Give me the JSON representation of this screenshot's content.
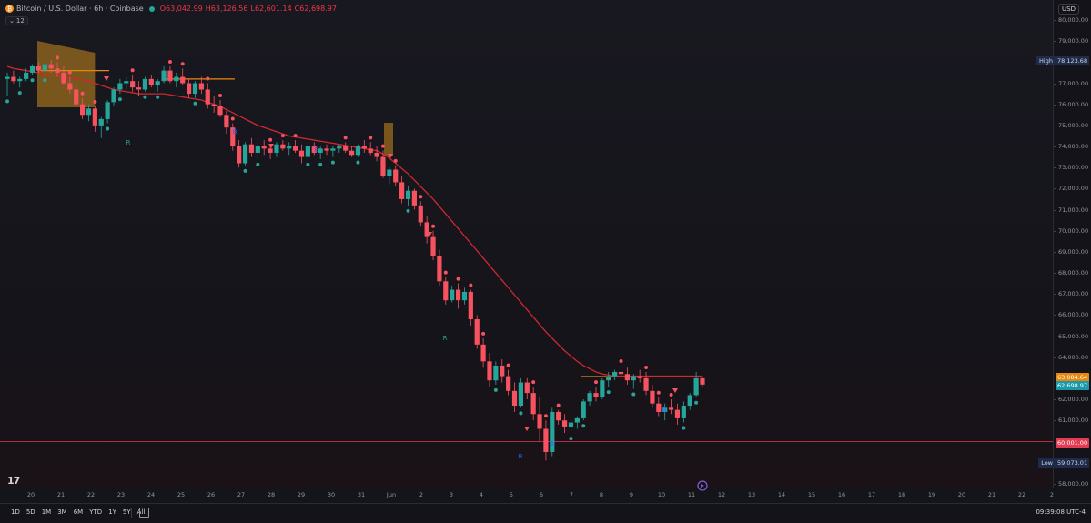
{
  "legend": {
    "symbol": "Bitcoin / U.S. Dollar · 6h · Coinbase",
    "open": "O63,042.99",
    "high": "H63,126.56",
    "low": "L62,601.14",
    "close": "C62,698.97"
  },
  "indicator_badge": "12",
  "currency": "USD",
  "price_axis": {
    "ticks": [
      "80,000.00",
      "79,000.00",
      "77,000.00",
      "76,000.00",
      "75,000.00",
      "74,000.00",
      "73,000.00",
      "72,000.00",
      "71,000.00",
      "70,000.00",
      "69,000.00",
      "68,000.00",
      "67,000.00",
      "66,000.00",
      "65,000.00",
      "64,000.00",
      "62,000.00",
      "61,000.00",
      "58,000.00"
    ],
    "labels": {
      "high_tag": "High",
      "high_value": "78,123.68",
      "level_orange": "63,084.64",
      "last_price": "62,698.97",
      "level_red": "60,001.00",
      "low_tag": "Low",
      "low_value": "59,073.01"
    }
  },
  "time_axis": [
    "20",
    "21",
    "22",
    "23",
    "24",
    "25",
    "26",
    "27",
    "28",
    "29",
    "30",
    "31",
    "Jun",
    "2",
    "3",
    "4",
    "5",
    "6",
    "7",
    "8",
    "9",
    "10",
    "11",
    "12",
    "13",
    "14",
    "15",
    "16",
    "17",
    "18",
    "19",
    "20",
    "21",
    "22",
    "2"
  ],
  "timeframes": [
    "1D",
    "5D",
    "1M",
    "3M",
    "6M",
    "YTD",
    "1Y",
    "5Y",
    "All"
  ],
  "clock": "09:39:08 UTC-4",
  "markers": {
    "buy": "B",
    "reversal": "R"
  },
  "colors": {
    "up": "#26a69a",
    "down": "#f7525f",
    "ma": "#d1272f",
    "band": "#c98a1c",
    "buy": "#2962ff"
  },
  "chart_data": {
    "type": "candlestick",
    "title": "Bitcoin / U.S. Dollar · 6h · Coinbase",
    "ylim": [
      58000,
      80200
    ],
    "x_labels": [
      "20",
      "21",
      "22",
      "23",
      "24",
      "25",
      "26",
      "27",
      "28",
      "29",
      "30",
      "31",
      "Jun",
      "2",
      "3",
      "4",
      "5",
      "6",
      "7",
      "8",
      "9",
      "10",
      "11"
    ],
    "candles": [
      [
        77200,
        77500,
        76400,
        77300
      ],
      [
        77300,
        77600,
        77000,
        77100
      ],
      [
        77100,
        77300,
        76800,
        77200
      ],
      [
        77200,
        77700,
        77100,
        77500
      ],
      [
        77500,
        77900,
        77400,
        77800
      ],
      [
        77800,
        78000,
        77500,
        77600
      ],
      [
        77600,
        78000,
        77400,
        77900
      ],
      [
        77900,
        78100,
        77500,
        77700
      ],
      [
        77700,
        78000,
        77300,
        77500
      ],
      [
        77500,
        77800,
        76900,
        77000
      ],
      [
        77000,
        77300,
        76500,
        76700
      ],
      [
        76700,
        77000,
        75800,
        76000
      ],
      [
        76000,
        76300,
        75300,
        75500
      ],
      [
        75500,
        76000,
        75200,
        75800
      ],
      [
        75800,
        75900,
        74700,
        75000
      ],
      [
        75000,
        75400,
        74400,
        75300
      ],
      [
        75300,
        76200,
        75100,
        76100
      ],
      [
        76100,
        76800,
        75900,
        76700
      ],
      [
        76700,
        77200,
        76500,
        77000
      ],
      [
        77000,
        77300,
        76700,
        77100
      ],
      [
        77100,
        77400,
        76600,
        76800
      ],
      [
        76800,
        77100,
        76400,
        76700
      ],
      [
        76700,
        77300,
        76600,
        77200
      ],
      [
        77200,
        77400,
        76800,
        76900
      ],
      [
        76900,
        77200,
        76600,
        77100
      ],
      [
        77100,
        77800,
        77000,
        77600
      ],
      [
        77600,
        77800,
        77000,
        77100
      ],
      [
        77100,
        77500,
        76800,
        77300
      ],
      [
        77300,
        77700,
        76900,
        77000
      ],
      [
        77000,
        77200,
        76300,
        76500
      ],
      [
        76500,
        77100,
        76300,
        77000
      ],
      [
        77000,
        77300,
        76500,
        76700
      ],
      [
        76700,
        77000,
        75800,
        76000
      ],
      [
        76000,
        76400,
        75600,
        75900
      ],
      [
        75900,
        76200,
        75400,
        75500
      ],
      [
        75500,
        75700,
        74600,
        74900
      ],
      [
        74900,
        75100,
        73800,
        74000
      ],
      [
        74000,
        74300,
        73000,
        73200
      ],
      [
        73200,
        74200,
        73100,
        74100
      ],
      [
        74100,
        74400,
        73500,
        73700
      ],
      [
        73700,
        74200,
        73400,
        74000
      ],
      [
        74000,
        74300,
        73600,
        73900
      ],
      [
        73900,
        74100,
        73400,
        73700
      ],
      [
        73700,
        74200,
        73500,
        74100
      ],
      [
        74100,
        74300,
        73800,
        73900
      ],
      [
        73900,
        74200,
        73600,
        74000
      ],
      [
        74000,
        74300,
        73700,
        73800
      ],
      [
        73800,
        74100,
        73200,
        73500
      ],
      [
        73500,
        74100,
        73400,
        74000
      ],
      [
        74000,
        74200,
        73600,
        73700
      ],
      [
        73700,
        74000,
        73400,
        73900
      ],
      [
        73900,
        74100,
        73600,
        73800
      ],
      [
        73800,
        74000,
        73500,
        73900
      ],
      [
        73900,
        74100,
        73700,
        74000
      ],
      [
        74000,
        74200,
        73700,
        73800
      ],
      [
        73800,
        74000,
        73500,
        73600
      ],
      [
        73600,
        74100,
        73500,
        74000
      ],
      [
        74000,
        74300,
        73700,
        73900
      ],
      [
        73900,
        74200,
        73600,
        73700
      ],
      [
        73700,
        74000,
        73300,
        73500
      ],
      [
        73500,
        73800,
        72500,
        72600
      ],
      [
        72600,
        73000,
        72200,
        72900
      ],
      [
        72900,
        73100,
        72100,
        72300
      ],
      [
        72300,
        72600,
        71300,
        71500
      ],
      [
        71500,
        72100,
        71200,
        71900
      ],
      [
        71900,
        72000,
        71000,
        71200
      ],
      [
        71200,
        71400,
        70200,
        70400
      ],
      [
        70400,
        70700,
        69400,
        69700
      ],
      [
        69700,
        70000,
        68600,
        68800
      ],
      [
        68800,
        69100,
        67400,
        67600
      ],
      [
        67600,
        67800,
        66500,
        66700
      ],
      [
        66700,
        67400,
        66600,
        67200
      ],
      [
        67200,
        67500,
        66300,
        66700
      ],
      [
        66700,
        67300,
        66500,
        67100
      ],
      [
        67100,
        67200,
        65500,
        65800
      ],
      [
        65800,
        66000,
        64400,
        64600
      ],
      [
        64600,
        64900,
        63500,
        63800
      ],
      [
        63800,
        64200,
        62600,
        62900
      ],
      [
        62900,
        63800,
        62700,
        63600
      ],
      [
        63600,
        63900,
        62800,
        63100
      ],
      [
        63100,
        63400,
        62200,
        62400
      ],
      [
        62400,
        62800,
        61400,
        61700
      ],
      [
        61700,
        63000,
        61600,
        62800
      ],
      [
        62800,
        63000,
        62000,
        62300
      ],
      [
        62300,
        62600,
        61000,
        61300
      ],
      [
        61300,
        62100,
        60000,
        60600
      ],
      [
        60600,
        61000,
        59100,
        59500
      ],
      [
        59500,
        61600,
        59300,
        61400
      ],
      [
        61400,
        61500,
        60800,
        61000
      ],
      [
        61000,
        61300,
        60400,
        60700
      ],
      [
        60700,
        61100,
        60400,
        60900
      ],
      [
        60900,
        61200,
        60600,
        61100
      ],
      [
        61100,
        62000,
        61000,
        61900
      ],
      [
        61900,
        62400,
        61700,
        62300
      ],
      [
        62300,
        62600,
        61900,
        62100
      ],
      [
        62100,
        63000,
        62000,
        62900
      ],
      [
        62900,
        63300,
        62600,
        63100
      ],
      [
        63100,
        63400,
        62900,
        63300
      ],
      [
        63300,
        63600,
        63000,
        63200
      ],
      [
        63200,
        63500,
        62700,
        62900
      ],
      [
        62900,
        63200,
        62500,
        63100
      ],
      [
        63100,
        63400,
        62800,
        63000
      ],
      [
        63000,
        63300,
        62200,
        62400
      ],
      [
        62400,
        62700,
        61600,
        61800
      ],
      [
        61800,
        62100,
        61200,
        61400
      ],
      [
        61400,
        61800,
        61000,
        61600
      ],
      [
        61600,
        62000,
        61300,
        61500
      ],
      [
        61500,
        61800,
        60800,
        61100
      ],
      [
        61100,
        61900,
        60900,
        61700
      ],
      [
        61700,
        62300,
        61500,
        62200
      ],
      [
        62200,
        63300,
        62100,
        63000
      ],
      [
        63000,
        63100,
        62600,
        62700
      ]
    ],
    "ma": [
      77800,
      77700,
      77650,
      77600,
      77550,
      77500,
      77450,
      77400,
      77350,
      77300,
      77250,
      77200,
      77150,
      77100,
      77000,
      76900,
      76800,
      76700,
      76650,
      76600,
      76550,
      76500,
      76500,
      76500,
      76500,
      76500,
      76450,
      76400,
      76350,
      76300,
      76250,
      76200,
      76100,
      76000,
      75900,
      75750,
      75600,
      75450,
      75300,
      75150,
      75000,
      74900,
      74800,
      74700,
      74600,
      74500,
      74450,
      74400,
      74350,
      74300,
      74250,
      74200,
      74150,
      74100,
      74050,
      74000,
      73950,
      73900,
      73850,
      73800,
      73650,
      73450,
      73200,
      72950,
      72700,
      72400,
      72100,
      71800,
      71500,
      71150,
      70800,
      70450,
      70100,
      69750,
      69400,
      69050,
      68700,
      68350,
      68000,
      67650,
      67300,
      66950,
      66600,
      66250,
      65900,
      65550,
      65200,
      64900,
      64600,
      64300,
      64050,
      63800,
      63600,
      63450,
      63300,
      63200,
      63150,
      63100,
      63100,
      63100,
      63100,
      63100,
      63100,
      63100,
      63100,
      63100,
      63100,
      63100,
      63100,
      63100,
      63100,
      63100
    ],
    "horizontal_levels": [
      63084.64,
      60001.0
    ],
    "high": 78123.68,
    "low": 59073.01,
    "last": 62698.97
  }
}
